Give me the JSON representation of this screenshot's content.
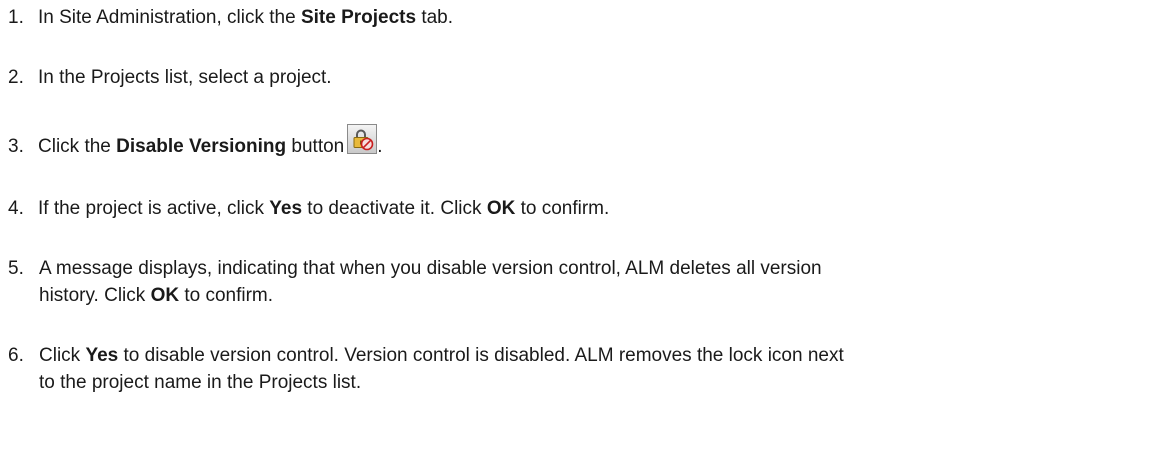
{
  "steps": [
    {
      "number": "1.",
      "prefix": "In Site Administration, click the ",
      "bold": "Site Projects",
      "suffix": " tab."
    },
    {
      "number": "2.",
      "text": "In the Projects list, select a project."
    },
    {
      "number": "3.",
      "prefix": "Click the ",
      "bold": "Disable Versioning",
      "suffix": " button",
      "icon": "disable-versioning-lock-icon",
      "after_icon": "."
    },
    {
      "number": "4.",
      "p1": "If the project is active, click ",
      "b1": "Yes",
      "p2": " to deactivate it. Click ",
      "b2": "OK",
      "p3": " to confirm."
    },
    {
      "number": "5.",
      "line1": "A message displays, indicating that when you disable version control, ALM deletes all version",
      "line2_prefix": "history. Click ",
      "line2_bold": "OK",
      "line2_suffix": " to confirm."
    },
    {
      "number": "6.",
      "line1_prefix": "Click ",
      "line1_bold": "Yes",
      "line1_suffix": " to disable version control. Version control is disabled. ALM removes the lock icon next",
      "line2": "to the project name in the Projects list."
    }
  ]
}
